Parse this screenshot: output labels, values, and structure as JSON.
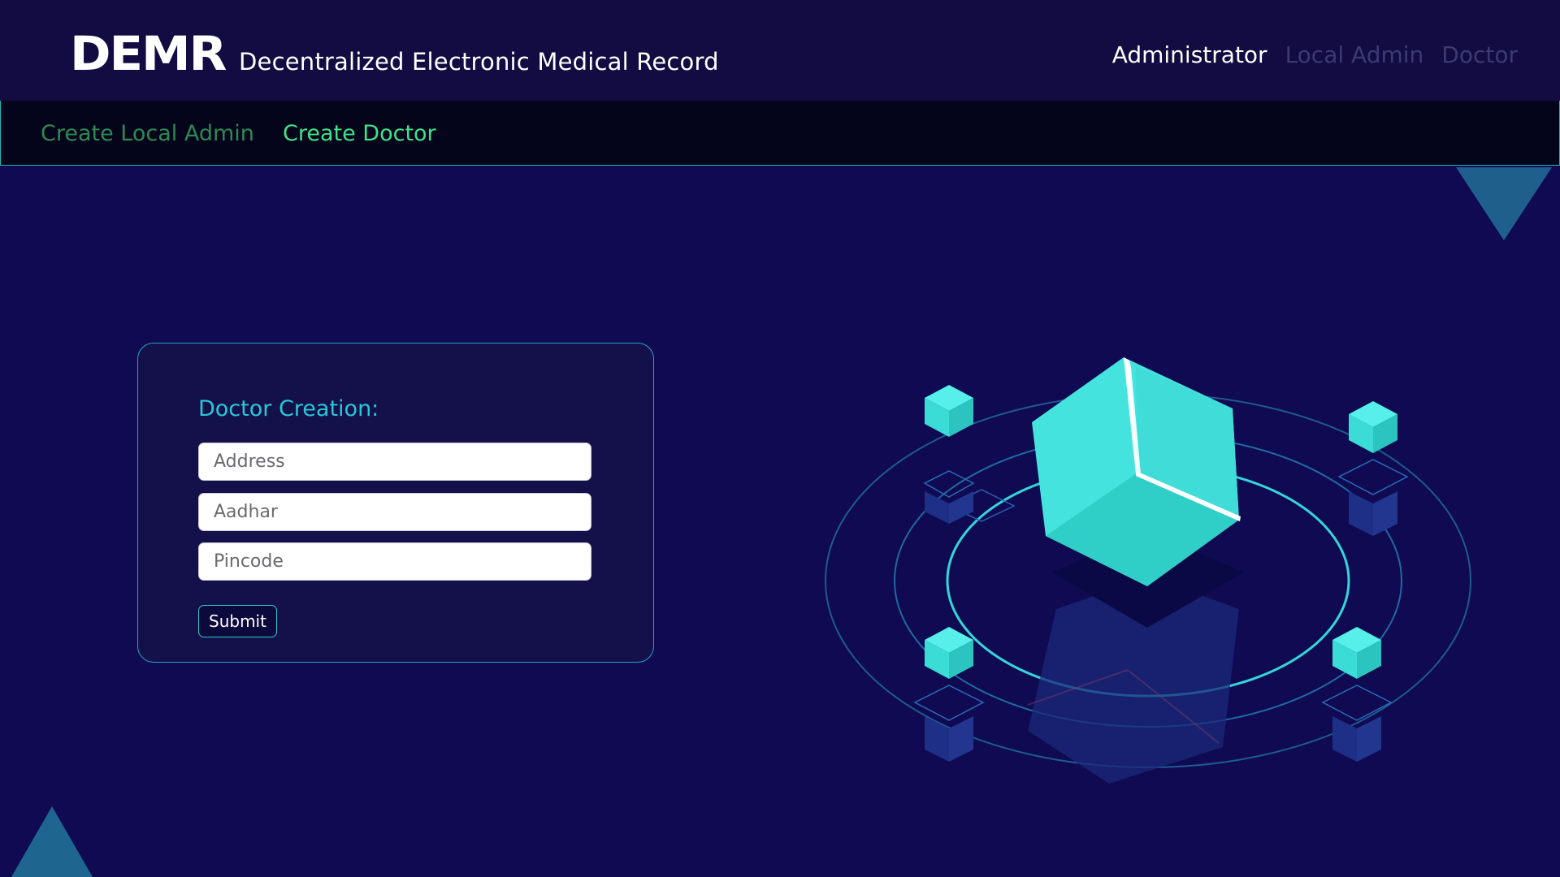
{
  "header": {
    "logo": "DEMR",
    "title": "Decentralized Electronic Medical Record",
    "roles": [
      "Administrator",
      "Local Admin",
      "Doctor"
    ]
  },
  "subnav": {
    "tabs": [
      "Create Local Admin",
      "Create Doctor"
    ]
  },
  "form": {
    "title": "Doctor Creation:",
    "fields": [
      {
        "placeholder": "Address",
        "value": ""
      },
      {
        "placeholder": "Aadhar",
        "value": ""
      },
      {
        "placeholder": "Pincode",
        "value": ""
      }
    ],
    "submit_label": "Submit"
  },
  "colors": {
    "background": "#0f0a52",
    "header": "#130c42",
    "accent": "#28c8d8",
    "cube": "#45e6e0",
    "active_tab": "#3fe388"
  },
  "icons": [
    "blockchain-cube-illustration",
    "triangle-decoration"
  ]
}
